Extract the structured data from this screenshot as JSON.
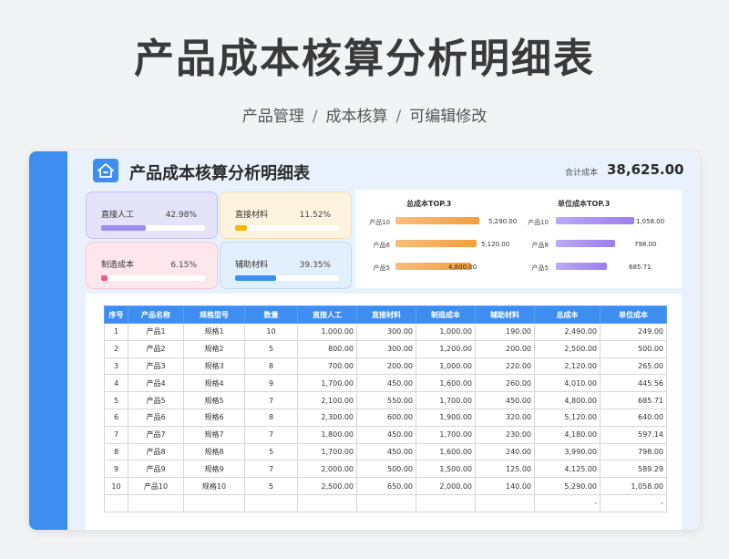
{
  "page": {
    "title": "产品成本核算分析明细表",
    "breadcrumb": [
      "产品管理",
      "成本核算",
      "可编辑修改"
    ]
  },
  "sheet": {
    "title": "产品成本核算分析明细表",
    "total_label": "合计成本",
    "total_value": "38,625.00"
  },
  "kpis": [
    {
      "label": "直接人工",
      "percent": "42.98%",
      "value": 0.4298,
      "color": "#9b8cf2"
    },
    {
      "label": "直接材料",
      "percent": "11.52%",
      "value": 0.1152,
      "color": "#f5b700"
    },
    {
      "label": "制造成本",
      "percent": "6.15%",
      "value": 0.0615,
      "color": "#f05c8a"
    },
    {
      "label": "辅助材料",
      "percent": "39.35%",
      "value": 0.3935,
      "color": "#3d8ef0"
    }
  ],
  "top3": {
    "total": {
      "title": "总成本TOP.3",
      "max": 5290,
      "color": "#f59e3c",
      "items": [
        {
          "name": "产品10",
          "value": 5290,
          "label": "5,290.00"
        },
        {
          "name": "产品6",
          "value": 5120,
          "label": "5,120.00"
        },
        {
          "name": "产品5",
          "value": 4800,
          "label": "4,800.00"
        }
      ]
    },
    "unit": {
      "title": "单位成本TOP.3",
      "max": 1058,
      "color": "#9b7ef0",
      "items": [
        {
          "name": "产品10",
          "value": 1058,
          "label": "1,058.00"
        },
        {
          "name": "产品8",
          "value": 798,
          "label": "798.00"
        },
        {
          "name": "产品5",
          "value": 685.71,
          "label": "685.71"
        }
      ]
    }
  },
  "table": {
    "headers": [
      "序号",
      "产品名称",
      "规格型号",
      "数量",
      "直接人工",
      "直接材料",
      "制造成本",
      "辅助材料",
      "总成本",
      "单位成本"
    ],
    "rows": [
      [
        "1",
        "产品1",
        "规格1",
        "10",
        "1,000.00",
        "300.00",
        "1,000.00",
        "190.00",
        "2,490.00",
        "249.00"
      ],
      [
        "2",
        "产品2",
        "规格2",
        "5",
        "800.00",
        "300.00",
        "1,200.00",
        "200.00",
        "2,500.00",
        "500.00"
      ],
      [
        "3",
        "产品3",
        "规格3",
        "8",
        "700.00",
        "200.00",
        "1,000.00",
        "220.00",
        "2,120.00",
        "265.00"
      ],
      [
        "4",
        "产品4",
        "规格4",
        "9",
        "1,700.00",
        "450.00",
        "1,600.00",
        "260.00",
        "4,010.00",
        "445.56"
      ],
      [
        "5",
        "产品5",
        "规格5",
        "7",
        "2,100.00",
        "550.00",
        "1,700.00",
        "450.00",
        "4,800.00",
        "685.71"
      ],
      [
        "6",
        "产品6",
        "规格6",
        "8",
        "2,300.00",
        "600.00",
        "1,900.00",
        "320.00",
        "5,120.00",
        "640.00"
      ],
      [
        "7",
        "产品7",
        "规格7",
        "7",
        "1,800.00",
        "450.00",
        "1,700.00",
        "230.00",
        "4,180.00",
        "597.14"
      ],
      [
        "8",
        "产品8",
        "规格8",
        "5",
        "1,700.00",
        "450.00",
        "1,600.00",
        "240.00",
        "3,990.00",
        "798.00"
      ],
      [
        "9",
        "产品9",
        "规格9",
        "7",
        "2,000.00",
        "500.00",
        "1,500.00",
        "125.00",
        "4,125.00",
        "589.29"
      ],
      [
        "10",
        "产品10",
        "规格10",
        "5",
        "2,500.00",
        "650.00",
        "2,000.00",
        "140.00",
        "5,290.00",
        "1,058.00"
      ],
      [
        "",
        "",
        "",
        "",
        "",
        "",
        "",
        "",
        "-",
        "-"
      ]
    ]
  }
}
